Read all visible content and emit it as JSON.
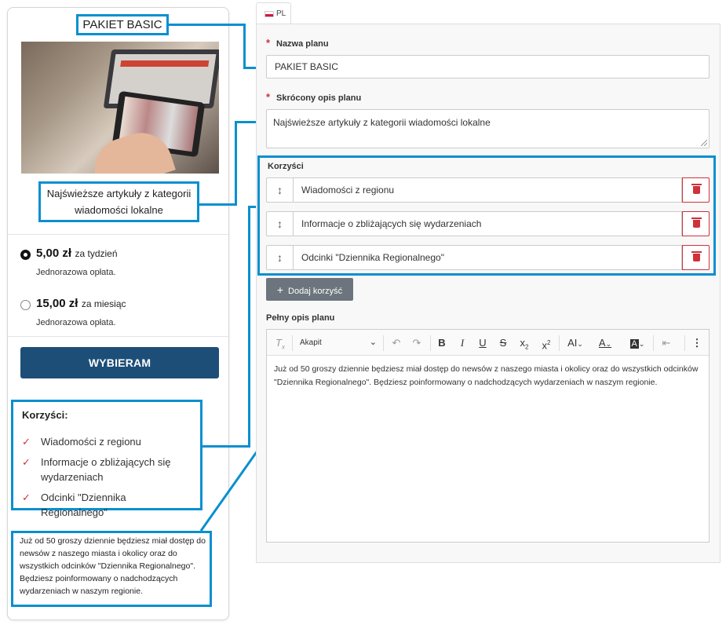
{
  "preview": {
    "plan_name": "PAKIET BASIC",
    "short_description": "Najświeższe artykuły z kategorii wiadomości lokalne",
    "prices": [
      {
        "amount": "5,00 zł",
        "period": "za tydzień",
        "note": "Jednorazowa opłata.",
        "selected": true
      },
      {
        "amount": "15,00 zł",
        "period": "za miesiąc",
        "note": "Jednorazowa opłata.",
        "selected": false
      }
    ],
    "choose_button": "WYBIERAM",
    "benefits_heading": "Korzyści:",
    "benefits": [
      "Wiadomości z regionu",
      "Informacje o zbliżających się wydarzeniach",
      "Odcinki \"Dziennika Regionalnego\""
    ],
    "full_description": "Już od 50 groszy dziennie będziesz miał dostęp do newsów z naszego miasta i okolicy oraz do wszystkich odcinków \"Dziennika Regionalnego\". Będziesz poinformowany o nadchodzących wydarzeniach w naszym regionie."
  },
  "form": {
    "language_tab": "PL",
    "name_label": "Nazwa planu",
    "name_value": "PAKIET BASIC",
    "short_label": "Skrócony opis planu",
    "short_value": "Najświeższe artykuły z kategorii wiadomości lokalne",
    "required_mark": "*",
    "benefits_label": "Korzyści",
    "benefits": [
      "Wiadomości z regionu",
      "Informacje o zbliżających się wydarzeniach",
      "Odcinki \"Dziennika Regionalnego\""
    ],
    "add_benefit_button": "Dodaj korzyść",
    "full_label": "Pełny opis planu",
    "editor": {
      "heading_select": "Akapit",
      "content": "Już od 50 groszy dziennie będziesz miał dostęp do newsów z naszego miasta i okolicy oraz do wszystkich odcinków \"Dziennika Regionalnego\". Będziesz poinformowany o nadchodzących wydarzeniach w naszym regionie.",
      "tools": [
        "clear-format",
        "undo",
        "redo",
        "bold",
        "italic",
        "underline",
        "strikethrough",
        "subscript",
        "superscript",
        "font-size",
        "font-color",
        "background-color",
        "outdent",
        "more"
      ]
    }
  },
  "colors": {
    "annotation_border": "#0a8fd0",
    "primary_button": "#1d4e77",
    "danger": "#d0313b",
    "secondary_button": "#6c757d"
  }
}
